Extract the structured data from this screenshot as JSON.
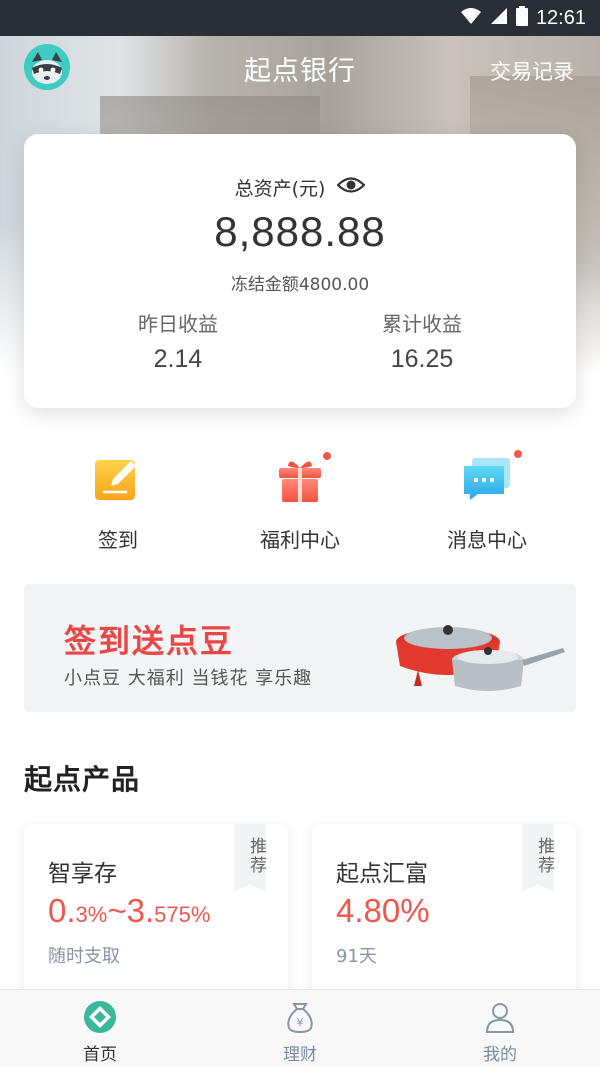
{
  "status_bar": {
    "time": "12:61"
  },
  "header": {
    "title": "起点银行",
    "trade_records": "交易记录"
  },
  "asset_card": {
    "label": "总资产(元)",
    "total": "8,888.88",
    "frozen": "冻结金额4800.00",
    "yesterday_label": "昨日收益",
    "yesterday_value": "2.14",
    "cumulative_label": "累计收益",
    "cumulative_value": "16.25"
  },
  "quick_actions": [
    {
      "label": "签到",
      "icon": "edit-icon",
      "badge": false
    },
    {
      "label": "福利中心",
      "icon": "gift-icon",
      "badge": true
    },
    {
      "label": "消息中心",
      "icon": "message-icon",
      "badge": true
    }
  ],
  "banner": {
    "title": "签到送点豆",
    "subtitle": "小点豆 大福利 当钱花 享乐趣"
  },
  "section": {
    "title": "起点产品"
  },
  "products": [
    {
      "name": "智享存",
      "rate_a_big": "0.",
      "rate_a_small": "3%",
      "sep": "~",
      "rate_b_big": "3.",
      "rate_b_small": "575%",
      "desc": "随时支取",
      "tag": "推荐"
    },
    {
      "name": "起点汇富",
      "rate": "4.80%",
      "desc": "91天",
      "tag": "推荐"
    }
  ],
  "bottom_nav": [
    {
      "label": "首页",
      "icon": "home-icon",
      "active": true
    },
    {
      "label": "理财",
      "icon": "money-bag-icon",
      "active": false
    },
    {
      "label": "我的",
      "icon": "profile-icon",
      "active": false
    }
  ],
  "colors": {
    "accent_red": "#f1564c",
    "brand_teal": "#3ecbc1",
    "text_dark": "#333333"
  }
}
